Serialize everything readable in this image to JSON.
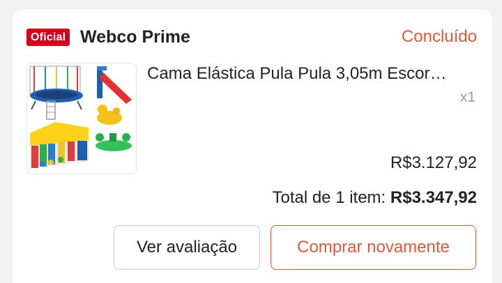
{
  "order": {
    "badge_label": "Oficial",
    "shop_name": "Webco Prime",
    "status": "Concluído",
    "product": {
      "title": "Cama Elástica Pula Pula 3,05m Escor…",
      "quantity": "x1",
      "price": "R$3.127,92",
      "image_icon": "playground-product-image"
    },
    "total_label": "Total de 1 item:",
    "total_value": "R$3.347,92",
    "buttons": {
      "review": "Ver avaliação",
      "buy_again": "Comprar novamente"
    }
  },
  "colors": {
    "accent": "#e2573a",
    "badge": "#d0011b"
  }
}
